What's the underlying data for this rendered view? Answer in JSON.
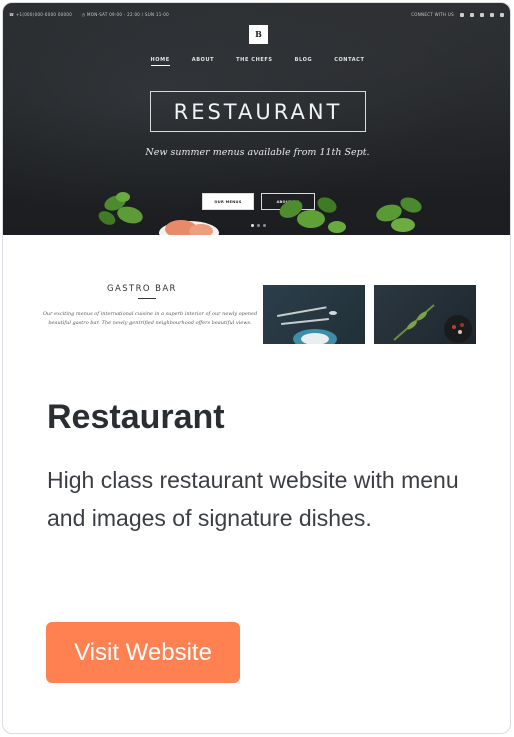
{
  "preview": {
    "topbar": {
      "phone": "☎ +1(000)000-0000 00000",
      "hours": "◷ MON-SAT 09:00 - 22:00 / SUN 11-00",
      "right_label": "CONNECT WITH US",
      "social_icons": [
        "facebook-icon",
        "twitter-icon",
        "instagram-icon",
        "pinterest-icon",
        "mail-icon"
      ]
    },
    "logo_letter": "B",
    "nav": [
      "HOME",
      "ABOUT",
      "THE CHEFS",
      "BLOG",
      "CONTACT"
    ],
    "brand": "RESTAURANT",
    "tagline": "New summer menus available from 11th Sept.",
    "buttons": {
      "primary": "OUR MENUS",
      "secondary": "ABOUT US"
    },
    "gastro": {
      "title": "GASTRO BAR",
      "text": "Our exciting menus of international cuisine in a superb interior of our newly opened beautiful gastro bar. The newly gentrified neighbourhood offers beautiful views."
    }
  },
  "card": {
    "title": "Restaurant",
    "description": "High class restaurant website with menu and images of signature dishes.",
    "button_label": "Visit Website"
  },
  "colors": {
    "accent": "#ff8152",
    "hero_bg": "#1f2124",
    "title_text": "#2a2d31"
  }
}
